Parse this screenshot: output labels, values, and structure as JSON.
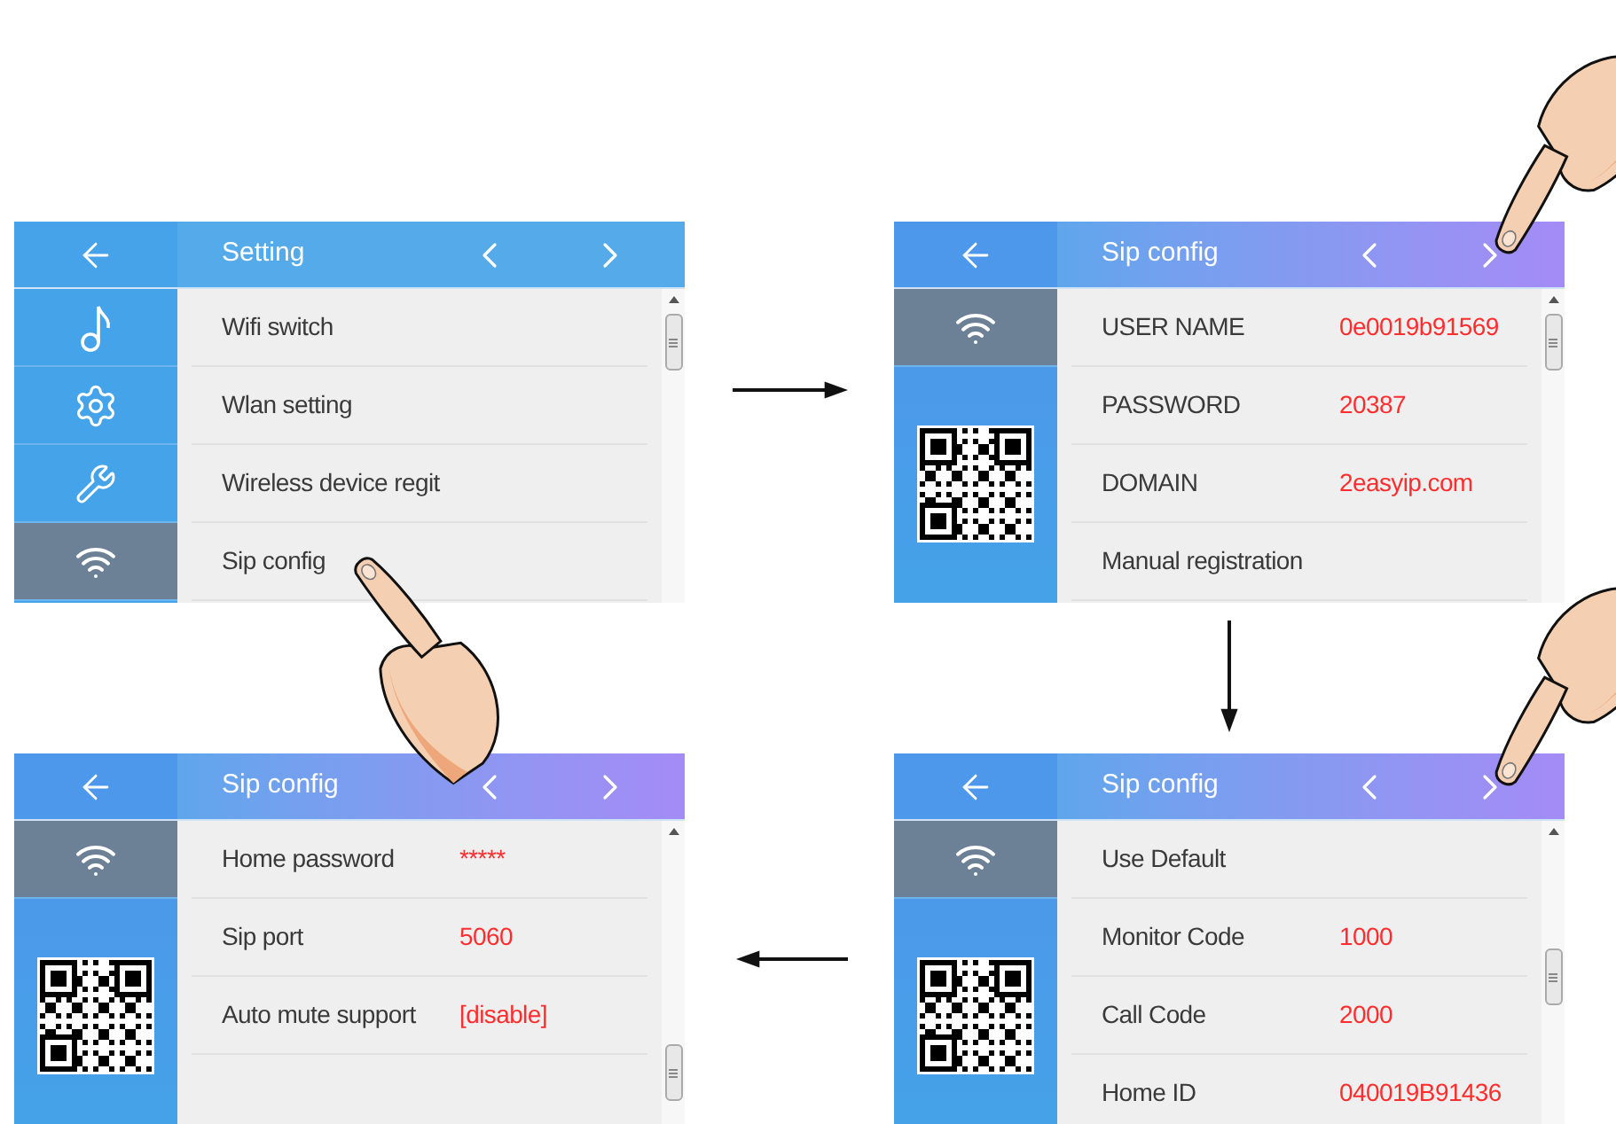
{
  "screens": [
    {
      "title": "Setting",
      "kind": "menu",
      "sidebar": [
        {
          "kind": "music",
          "selected": false
        },
        {
          "kind": "settings",
          "selected": false
        },
        {
          "kind": "tools",
          "selected": false
        },
        {
          "kind": "wifi",
          "selected": true
        }
      ],
      "rows": [
        {
          "label": "Wifi switch"
        },
        {
          "label": "Wlan setting"
        },
        {
          "label": "Wireless device regit"
        },
        {
          "label": "Sip config"
        }
      ]
    },
    {
      "title": "Sip config",
      "kind": "sip",
      "sidebar": [
        {
          "kind": "wifi",
          "selected": true
        }
      ],
      "rows": [
        {
          "label": "USER NAME",
          "value": "0e0019b91569"
        },
        {
          "label": "PASSWORD",
          "value": "20387"
        },
        {
          "label": "DOMAIN",
          "value": "2easyip.com"
        },
        {
          "label": "Manual registration"
        }
      ]
    },
    {
      "title": "Sip config",
      "kind": "sip",
      "sidebar": [
        {
          "kind": "wifi",
          "selected": true
        }
      ],
      "rows": [
        {
          "label": "Home password",
          "value": "*****"
        },
        {
          "label": "Sip port",
          "value": "5060"
        },
        {
          "label": "Auto mute support",
          "value": "[disable]"
        }
      ]
    },
    {
      "title": "Sip config",
      "kind": "sip",
      "sidebar": [
        {
          "kind": "wifi",
          "selected": true
        }
      ],
      "rows": [
        {
          "label": "Use Default"
        },
        {
          "label": "Monitor Code",
          "value": "1000"
        },
        {
          "label": "Call Code",
          "value": "2000"
        },
        {
          "label": "Home ID",
          "value": "040019B91436"
        }
      ]
    }
  ]
}
